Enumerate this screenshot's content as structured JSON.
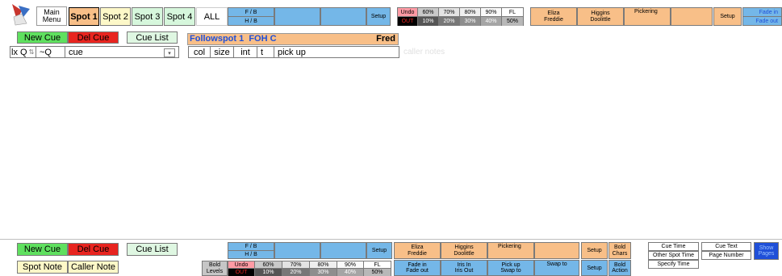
{
  "top": {
    "main_menu": "Main\nMenu",
    "spots": [
      "Spot 1",
      "Spot 2",
      "Spot 3",
      "Spot 4"
    ],
    "all_label": "ALL",
    "fb_label": "F / B",
    "hb_label": "H / B",
    "setup_label": "Setup",
    "levels_top": [
      "Undo",
      "60%",
      "70%",
      "80%",
      "90%",
      "FL"
    ],
    "levels_bottom": [
      "OUT",
      "10%",
      "20%",
      "30%",
      "40%",
      "50%"
    ],
    "names": [
      {
        "top": "Eliza",
        "bottom": "Freddie"
      },
      {
        "top": "Higgins",
        "bottom": "Doolittle"
      },
      {
        "top": "Pickering",
        "bottom": ""
      }
    ],
    "setup2_label": "Setup",
    "fade_in": "Fade in",
    "fade_out": "Fade out"
  },
  "cue_bar": {
    "new_cue": "New Cue",
    "del_cue": "Del Cue",
    "cue_list": "Cue List",
    "followspot_title": "Followspot 1  FOH C",
    "operator": "Fred"
  },
  "columns": {
    "lx_q": "lx Q",
    "spot_q": "~Q",
    "cue": "cue",
    "col": "col",
    "size": "size",
    "int": "int",
    "t": "t",
    "pick_up": "pick up",
    "caller_notes_placeholder": "caller notes"
  },
  "bottom": {
    "new_cue": "New Cue",
    "del_cue": "Del Cue",
    "cue_list": "Cue List",
    "spot_note": "Spot Note",
    "caller_note": "Caller Note",
    "fb_label": "F / B",
    "hb_label": "H / B",
    "setup_label": "Setup",
    "bold_levels": "Bold\nLevels",
    "levels_top": [
      "Undo",
      "60%",
      "70%",
      "80%",
      "90%",
      "FL"
    ],
    "levels_bottom": [
      "OUT",
      "10%",
      "20%",
      "30%",
      "40%",
      "50%"
    ],
    "names": [
      {
        "top": "Eliza",
        "bottom": "Freddie"
      },
      {
        "top": "Higgins",
        "bottom": "Doolittle"
      },
      {
        "top": "Pickering",
        "bottom": ""
      }
    ],
    "setup2_label": "Setup",
    "bold_chars": "Bold\nChars",
    "actions_top": [
      "Fade in",
      "Iris In",
      "Pick up",
      "Swap to"
    ],
    "actions_bottom": [
      "Fade out",
      "Iris Out",
      "Swap to",
      ""
    ],
    "setup3_label": "Setup",
    "bold_action": "Bold\nAction",
    "cue_time": "Cue Time",
    "other_spot_time": "Other Spot Time",
    "specify_time": "Specify Time",
    "cue_text": "Cue Text",
    "page_number": "Page Number",
    "show_pages": "Show\nPages"
  },
  "colors": {
    "blue": "#74b7e8",
    "orange": "#f8bf88",
    "green": "#5fe05f",
    "red": "#e8241f",
    "dark_blue": "#1f4fd8"
  }
}
